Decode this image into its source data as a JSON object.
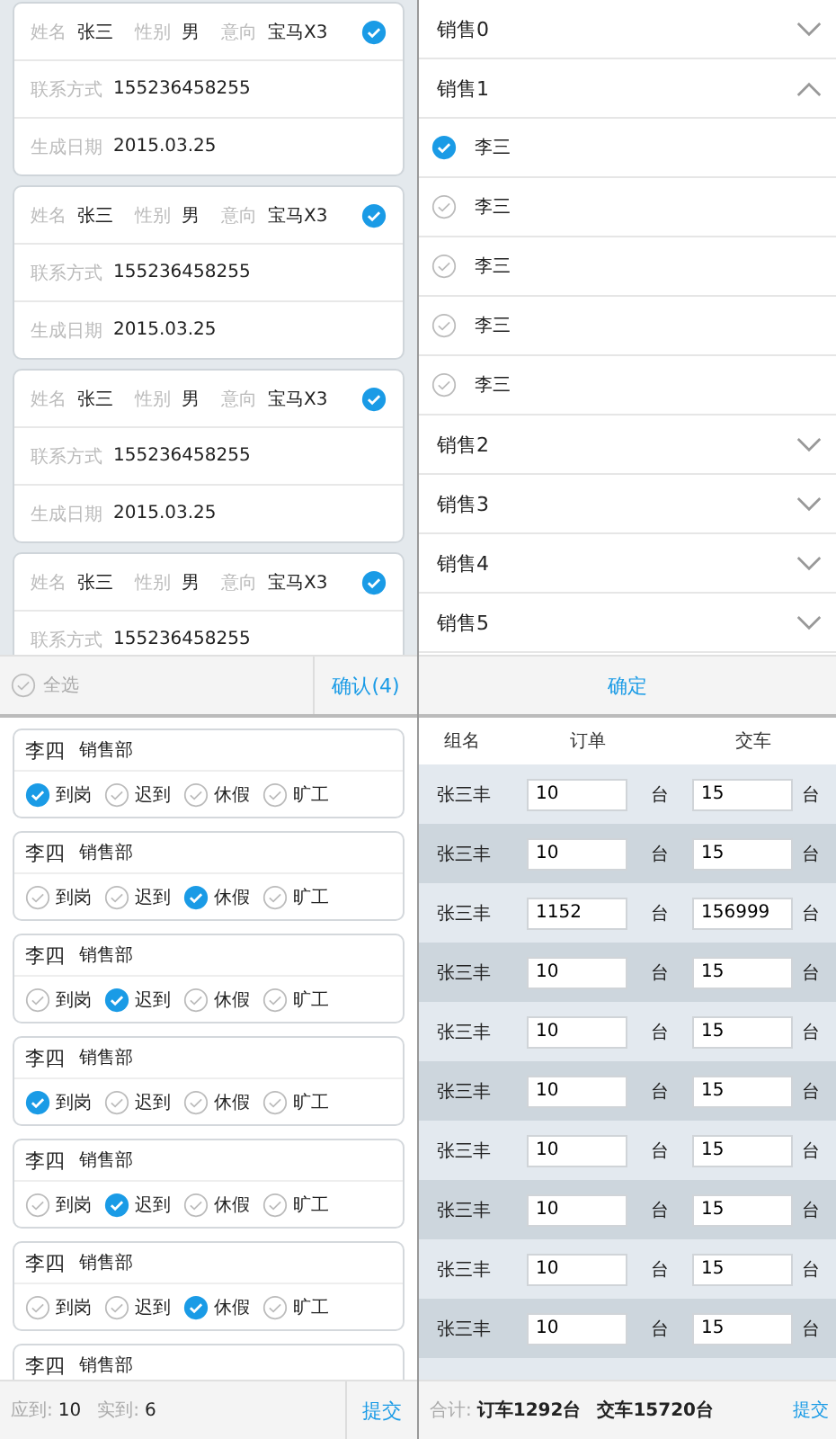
{
  "customer_list": {
    "cards": [
      {
        "checked": true,
        "summary": [
          {
            "label": "姓名",
            "value": "张三"
          },
          {
            "label": "性别",
            "value": "男"
          },
          {
            "label": "意向",
            "value": "宝马X3"
          }
        ],
        "details": [
          {
            "label": "联系方式",
            "value": "155236458255"
          },
          {
            "label": "生成日期",
            "value": "2015.03.25"
          }
        ]
      },
      {
        "checked": true,
        "summary": [
          {
            "label": "姓名",
            "value": "张三"
          },
          {
            "label": "性别",
            "value": "男"
          },
          {
            "label": "意向",
            "value": "宝马X3"
          }
        ],
        "details": [
          {
            "label": "联系方式",
            "value": "155236458255"
          },
          {
            "label": "生成日期",
            "value": "2015.03.25"
          }
        ]
      },
      {
        "checked": true,
        "summary": [
          {
            "label": "姓名",
            "value": "张三"
          },
          {
            "label": "性别",
            "value": "男"
          },
          {
            "label": "意向",
            "value": "宝马X3"
          }
        ],
        "details": [
          {
            "label": "联系方式",
            "value": "155236458255"
          },
          {
            "label": "生成日期",
            "value": "2015.03.25"
          }
        ]
      },
      {
        "checked": true,
        "summary": [
          {
            "label": "姓名",
            "value": "张三"
          },
          {
            "label": "性别",
            "value": "男"
          },
          {
            "label": "意向",
            "value": "宝马X3"
          }
        ],
        "details": [
          {
            "label": "联系方式",
            "value": "155236458255"
          }
        ]
      }
    ],
    "footer": {
      "select_all": {
        "label": "全选",
        "checked": false
      },
      "confirm": "确认(4)"
    }
  },
  "sales_groups": {
    "groups": [
      {
        "title": "销售0",
        "expanded": false
      },
      {
        "title": "销售1",
        "expanded": true,
        "members": [
          {
            "name": "李三",
            "checked": true
          },
          {
            "name": "李三",
            "checked": false
          },
          {
            "name": "李三",
            "checked": false
          },
          {
            "name": "李三",
            "checked": false
          },
          {
            "name": "李三",
            "checked": false
          }
        ]
      },
      {
        "title": "销售2",
        "expanded": false
      },
      {
        "title": "销售3",
        "expanded": false
      },
      {
        "title": "销售4",
        "expanded": false
      },
      {
        "title": "销售5",
        "expanded": false
      }
    ],
    "confirm": "确定"
  },
  "attendance": {
    "cards": [
      {
        "name": "李四",
        "dept": "销售部",
        "options": [
          {
            "label": "到岗",
            "selected": true
          },
          {
            "label": "迟到",
            "selected": false
          },
          {
            "label": "休假",
            "selected": false
          },
          {
            "label": "旷工",
            "selected": false
          }
        ]
      },
      {
        "name": "李四",
        "dept": "销售部",
        "options": [
          {
            "label": "到岗",
            "selected": false
          },
          {
            "label": "迟到",
            "selected": false
          },
          {
            "label": "休假",
            "selected": true
          },
          {
            "label": "旷工",
            "selected": false
          }
        ]
      },
      {
        "name": "李四",
        "dept": "销售部",
        "options": [
          {
            "label": "到岗",
            "selected": false
          },
          {
            "label": "迟到",
            "selected": true
          },
          {
            "label": "休假",
            "selected": false
          },
          {
            "label": "旷工",
            "selected": false
          }
        ]
      },
      {
        "name": "李四",
        "dept": "销售部",
        "options": [
          {
            "label": "到岗",
            "selected": true
          },
          {
            "label": "迟到",
            "selected": false
          },
          {
            "label": "休假",
            "selected": false
          },
          {
            "label": "旷工",
            "selected": false
          }
        ]
      },
      {
        "name": "李四",
        "dept": "销售部",
        "options": [
          {
            "label": "到岗",
            "selected": false
          },
          {
            "label": "迟到",
            "selected": true
          },
          {
            "label": "休假",
            "selected": false
          },
          {
            "label": "旷工",
            "selected": false
          }
        ]
      },
      {
        "name": "李四",
        "dept": "销售部",
        "options": [
          {
            "label": "到岗",
            "selected": false
          },
          {
            "label": "迟到",
            "selected": false
          },
          {
            "label": "休假",
            "selected": true
          },
          {
            "label": "旷工",
            "selected": false
          }
        ]
      },
      {
        "name": "李四",
        "dept": "销售部"
      }
    ],
    "footer": {
      "expected_label": "应到:",
      "expected": "10",
      "actual_label": "实到:",
      "actual": "6",
      "submit": "提交"
    }
  },
  "orders_table": {
    "columns": [
      "组名",
      "订单",
      "交车"
    ],
    "rows": [
      {
        "group": "张三丰",
        "order": "10",
        "order_unit": "台",
        "delivery": "15",
        "delivery_unit": "台"
      },
      {
        "group": "张三丰",
        "order": "10",
        "order_unit": "台",
        "delivery": "15",
        "delivery_unit": "台"
      },
      {
        "group": "张三丰",
        "order": "1152",
        "order_unit": "台",
        "delivery": "156999",
        "delivery_unit": "台"
      },
      {
        "group": "张三丰",
        "order": "10",
        "order_unit": "台",
        "delivery": "15",
        "delivery_unit": "台"
      },
      {
        "group": "张三丰",
        "order": "10",
        "order_unit": "台",
        "delivery": "15",
        "delivery_unit": "台"
      },
      {
        "group": "张三丰",
        "order": "10",
        "order_unit": "台",
        "delivery": "15",
        "delivery_unit": "台"
      },
      {
        "group": "张三丰",
        "order": "10",
        "order_unit": "台",
        "delivery": "15",
        "delivery_unit": "台"
      },
      {
        "group": "张三丰",
        "order": "10",
        "order_unit": "台",
        "delivery": "15",
        "delivery_unit": "台"
      },
      {
        "group": "张三丰",
        "order": "10",
        "order_unit": "台",
        "delivery": "15",
        "delivery_unit": "台"
      },
      {
        "group": "张三丰",
        "order": "10",
        "order_unit": "台",
        "delivery": "15",
        "delivery_unit": "台"
      }
    ],
    "footer": {
      "total_label": "合计:",
      "order_total": "订车1292台",
      "delivery_total": "交车15720台",
      "submit": "提交"
    }
  }
}
